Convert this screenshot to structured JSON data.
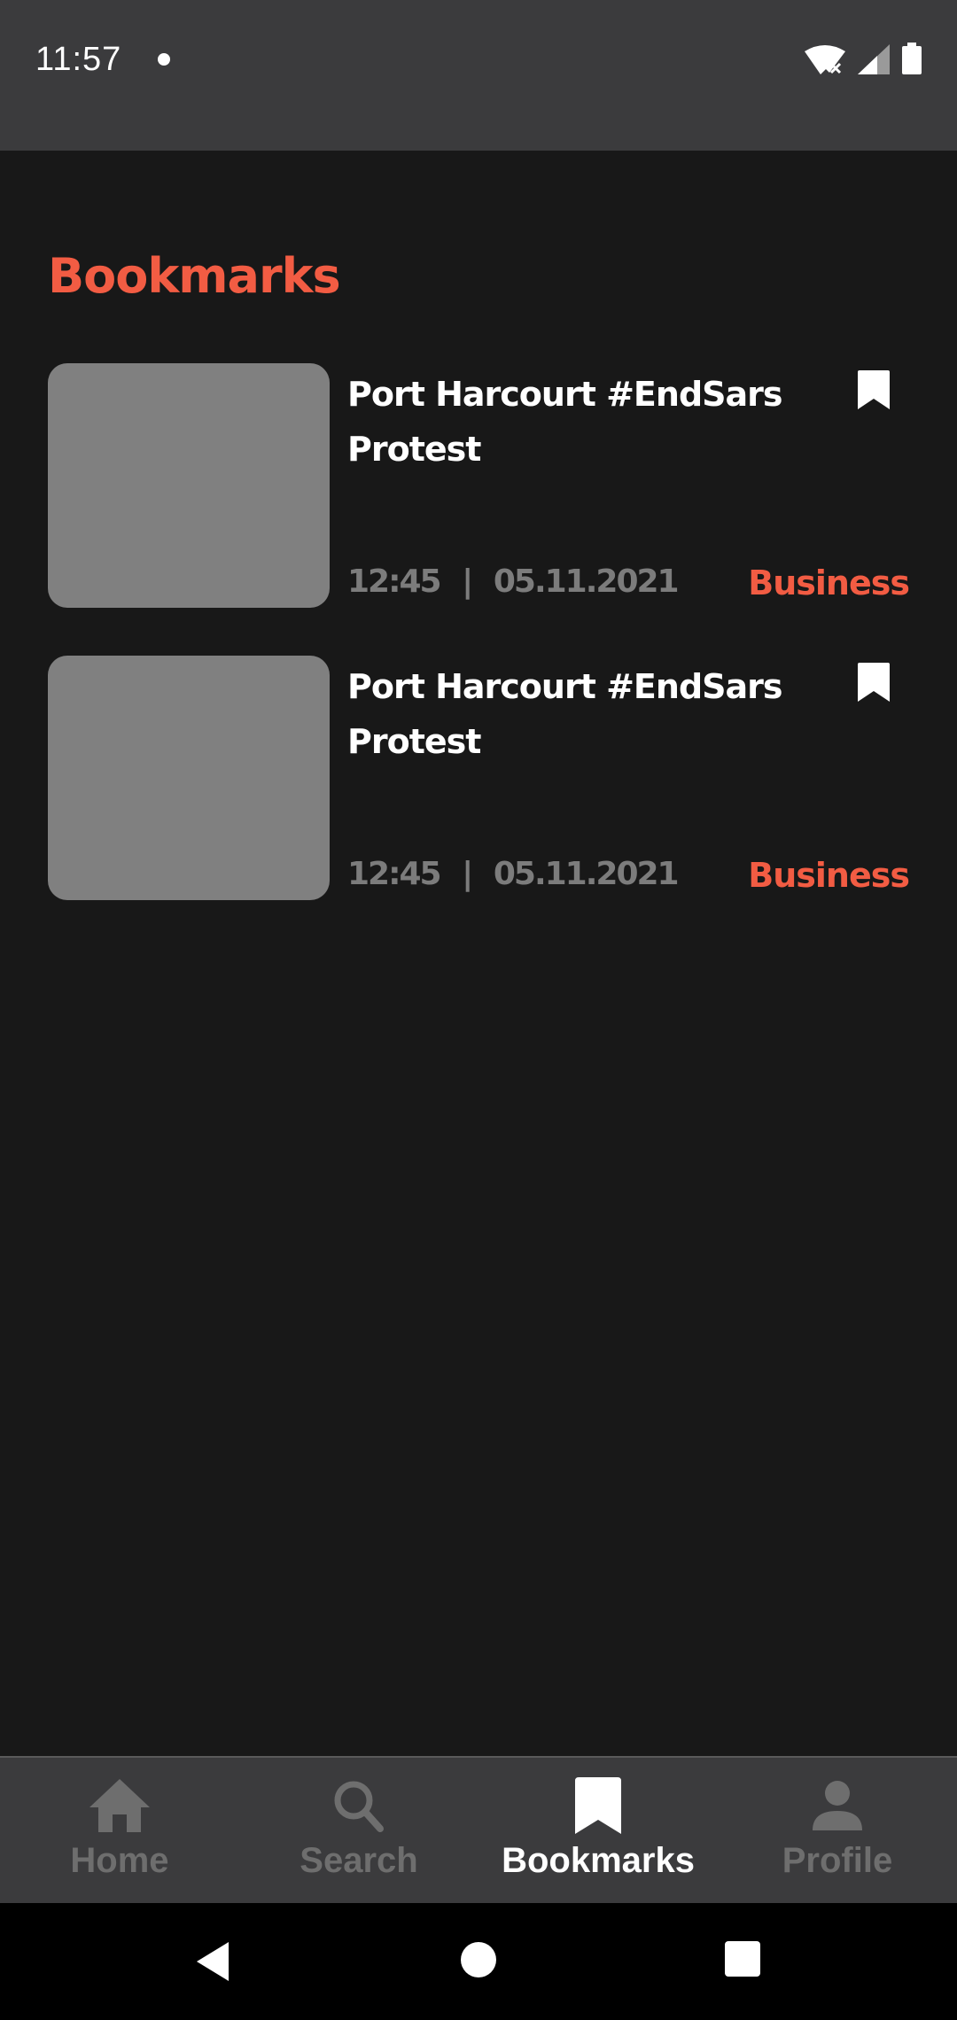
{
  "status_bar": {
    "time": "11:57"
  },
  "page_title": "Bookmarks",
  "bookmarks": [
    {
      "title": "Port Harcourt #EndSars Protest",
      "time": "12:45",
      "date": "05.11.2021",
      "category": "Business"
    },
    {
      "title": "Port Harcourt #EndSars Protest",
      "time": "12:45",
      "date": "05.11.2021",
      "category": "Business"
    }
  ],
  "meta_separator": "|",
  "nav": {
    "items": [
      {
        "label": "Home",
        "icon": "home-icon",
        "active": false
      },
      {
        "label": "Search",
        "icon": "search-icon",
        "active": false
      },
      {
        "label": "Bookmarks",
        "icon": "bookmark-icon",
        "active": true
      },
      {
        "label": "Profile",
        "icon": "person-icon",
        "active": false
      }
    ]
  },
  "colors": {
    "accent": "#f25c43",
    "background": "#181818",
    "bar": "#3b3b3d",
    "placeholder": "#808080"
  }
}
